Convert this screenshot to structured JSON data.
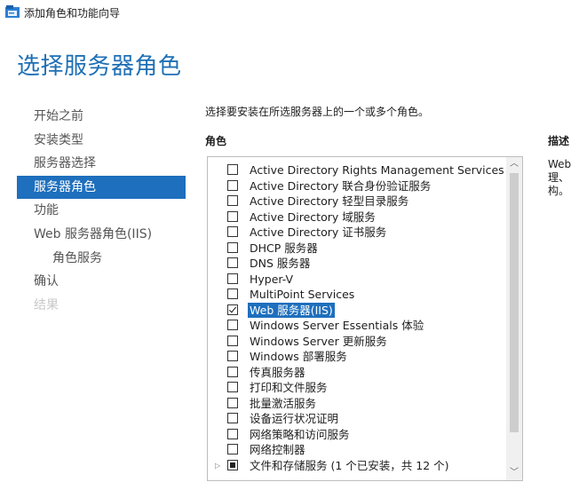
{
  "window": {
    "title": "添加角色和功能向导",
    "icon": "server-manager-icon"
  },
  "page_title": "选择服务器角色",
  "nav": {
    "items": [
      {
        "label": "开始之前",
        "state": "normal"
      },
      {
        "label": "安装类型",
        "state": "normal"
      },
      {
        "label": "服务器选择",
        "state": "normal"
      },
      {
        "label": "服务器角色",
        "state": "active"
      },
      {
        "label": "功能",
        "state": "normal"
      },
      {
        "label": "Web 服务器角色(IIS)",
        "state": "normal"
      },
      {
        "label": "角色服务",
        "state": "sub"
      },
      {
        "label": "确认",
        "state": "normal"
      },
      {
        "label": "结果",
        "state": "disabled"
      }
    ]
  },
  "instruction": "选择要安装在所选服务器上的一个或多个角色。",
  "roles": {
    "heading": "角色",
    "items": [
      {
        "label": "Active Directory Rights Management Services",
        "checked": false
      },
      {
        "label": "Active Directory 联合身份验证服务",
        "checked": false
      },
      {
        "label": "Active Directory 轻型目录服务",
        "checked": false
      },
      {
        "label": "Active Directory 域服务",
        "checked": false
      },
      {
        "label": "Active Directory 证书服务",
        "checked": false
      },
      {
        "label": "DHCP 服务器",
        "checked": false
      },
      {
        "label": "DNS 服务器",
        "checked": false
      },
      {
        "label": "Hyper-V",
        "checked": false
      },
      {
        "label": "MultiPoint Services",
        "checked": false
      },
      {
        "label": "Web 服务器(IIS)",
        "checked": true,
        "selected": true
      },
      {
        "label": "Windows Server Essentials 体验",
        "checked": false
      },
      {
        "label": "Windows Server 更新服务",
        "checked": false
      },
      {
        "label": "Windows 部署服务",
        "checked": false
      },
      {
        "label": "传真服务器",
        "checked": false
      },
      {
        "label": "打印和文件服务",
        "checked": false
      },
      {
        "label": "批量激活服务",
        "checked": false
      },
      {
        "label": "设备运行状况证明",
        "checked": false
      },
      {
        "label": "网络策略和访问服务",
        "checked": false
      },
      {
        "label": "网络控制器",
        "checked": false
      },
      {
        "label": "文件和存储服务 (1 个已安装，共 12 个)",
        "checked": "partial",
        "expandable": true
      }
    ]
  },
  "description": {
    "heading": "描述",
    "text": "Web 理、 构。"
  },
  "colors": {
    "accent": "#1e6fbd",
    "page_title": "#1f6fb5"
  }
}
